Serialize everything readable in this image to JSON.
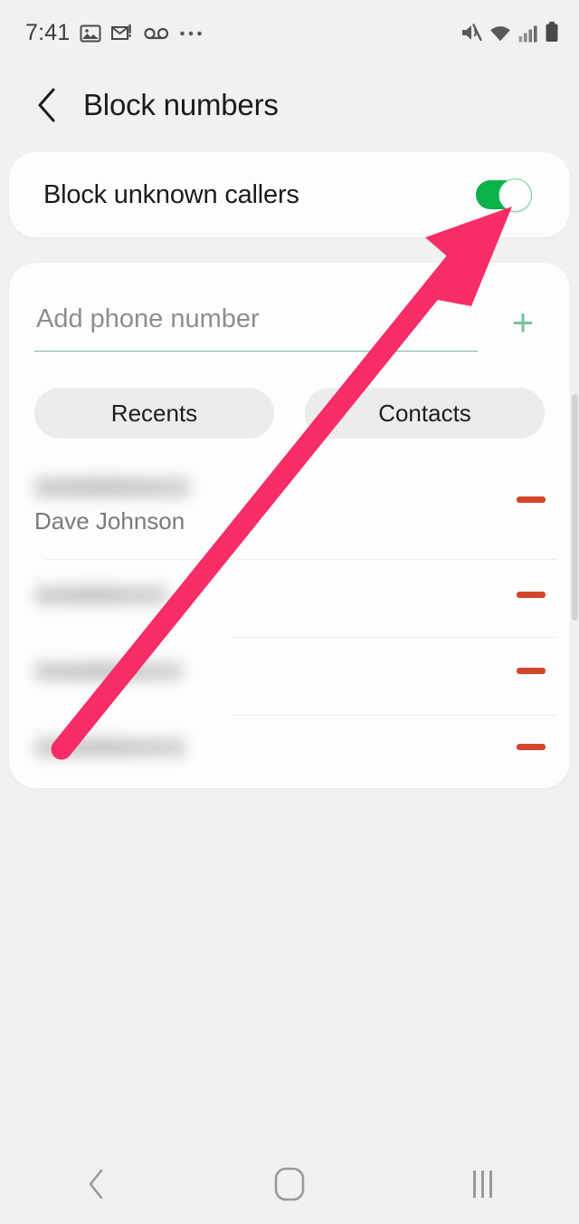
{
  "status_bar": {
    "time": "7:41",
    "left_icons": [
      "image-icon",
      "email-icon",
      "voicemail-icon",
      "more-icon"
    ],
    "right_icons": [
      "mute-icon",
      "wifi-icon",
      "signal-icon",
      "battery-icon"
    ]
  },
  "header": {
    "back_icon": "chevron-left-icon",
    "title": "Block numbers"
  },
  "block_unknown": {
    "label": "Block unknown callers",
    "toggle_state": "on",
    "toggle_color": "#0bb14a"
  },
  "add_number": {
    "placeholder": "Add phone number",
    "value": "",
    "add_label": "+",
    "underline_color": "#7ab79a",
    "add_icon_color": "#72c79c"
  },
  "source_tabs": [
    {
      "label": "Recents",
      "name": "recents"
    },
    {
      "label": "Contacts",
      "name": "contacts"
    }
  ],
  "blocked_numbers": [
    {
      "number": "",
      "number_redacted": true,
      "subtitle": "Dave Johnson",
      "remove_label": ""
    },
    {
      "number": "",
      "number_redacted": true,
      "subtitle": "",
      "remove_label": ""
    },
    {
      "number": "",
      "number_redacted": true,
      "subtitle": "",
      "remove_label": ""
    },
    {
      "number": "",
      "number_redacted": true,
      "subtitle": "",
      "remove_label": ""
    }
  ],
  "remove_button_color": "#d4462b",
  "annotation": {
    "type": "arrow",
    "color": "#f72d67",
    "points_to": "block-unknown-callers-toggle"
  },
  "nav_bar": {
    "back_label": "back-icon",
    "home_label": "home-icon",
    "recents_label": "recents-icon"
  }
}
